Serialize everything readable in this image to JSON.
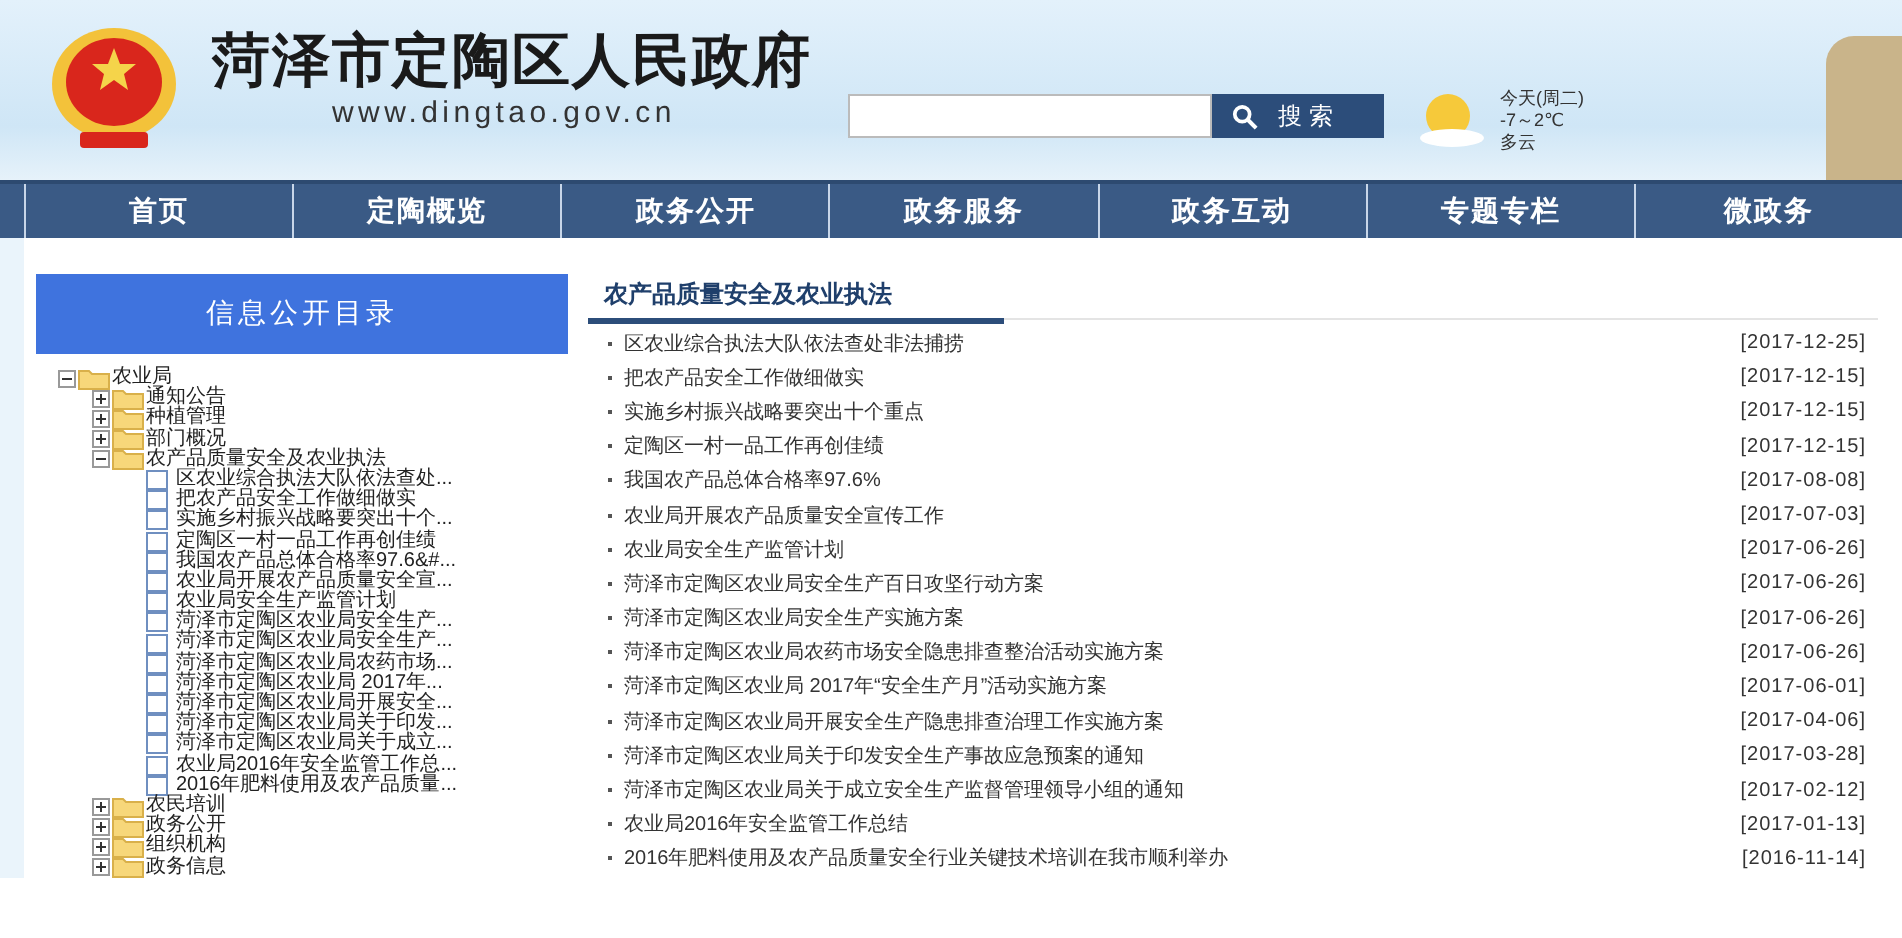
{
  "header": {
    "title": "菏泽市定陶区人民政府",
    "url": "www.dingtao.gov.cn",
    "search": {
      "button": "搜 索"
    },
    "weather": {
      "day": "今天(周二)",
      "temp": "-7～2℃",
      "sky": "多云"
    }
  },
  "nav": [
    "首页",
    "定陶概览",
    "政务公开",
    "政务服务",
    "政务互动",
    "专题专栏",
    "微政务"
  ],
  "sidebar": {
    "title": "信息公开目录",
    "tree": [
      {
        "label": "农业局",
        "kind": "folder",
        "expanded": true,
        "children": [
          {
            "label": "通知公告",
            "kind": "folder",
            "expanded": false
          },
          {
            "label": "种植管理",
            "kind": "folder",
            "expanded": false
          },
          {
            "label": "部门概况",
            "kind": "folder",
            "expanded": false
          },
          {
            "label": "农产品质量安全及农业执法",
            "kind": "folder",
            "expanded": true,
            "children": [
              {
                "label": "区农业综合执法大队依法查处...",
                "kind": "doc"
              },
              {
                "label": "把农产品安全工作做细做实",
                "kind": "doc"
              },
              {
                "label": "实施乡村振兴战略要突出十个...",
                "kind": "doc"
              },
              {
                "label": "定陶区一村一品工作再创佳绩",
                "kind": "doc"
              },
              {
                "label": "我国农产品总体合格率97.6&#...",
                "kind": "doc"
              },
              {
                "label": "农业局开展农产品质量安全宣...",
                "kind": "doc"
              },
              {
                "label": "农业局安全生产监管计划",
                "kind": "doc"
              },
              {
                "label": "菏泽市定陶区农业局安全生产...",
                "kind": "doc"
              },
              {
                "label": "菏泽市定陶区农业局安全生产...",
                "kind": "doc"
              },
              {
                "label": "菏泽市定陶区农业局农药市场...",
                "kind": "doc"
              },
              {
                "label": "菏泽市定陶区农业局 2017年...",
                "kind": "doc"
              },
              {
                "label": "菏泽市定陶区农业局开展安全...",
                "kind": "doc"
              },
              {
                "label": "菏泽市定陶区农业局关于印发...",
                "kind": "doc"
              },
              {
                "label": "菏泽市定陶区农业局关于成立...",
                "kind": "doc"
              },
              {
                "label": "农业局2016年安全监管工作总...",
                "kind": "doc"
              },
              {
                "label": "2016年肥料使用及农产品质量...",
                "kind": "doc"
              }
            ]
          },
          {
            "label": "农民培训",
            "kind": "folder",
            "expanded": false
          },
          {
            "label": "政务公开",
            "kind": "folder",
            "expanded": false
          },
          {
            "label": "组织机构",
            "kind": "folder",
            "expanded": false
          },
          {
            "label": "政务信息",
            "kind": "folder",
            "expanded": false
          }
        ]
      }
    ]
  },
  "content": {
    "title": "农产品质量安全及农业执法",
    "items": [
      {
        "title": "区农业综合执法大队依法查处非法捕捞",
        "date": "[2017-12-25]"
      },
      {
        "title": "把农产品安全工作做细做实",
        "date": "[2017-12-15]"
      },
      {
        "title": "实施乡村振兴战略要突出十个重点",
        "date": "[2017-12-15]"
      },
      {
        "title": "定陶区一村一品工作再创佳绩",
        "date": "[2017-12-15]"
      },
      {
        "title": "我国农产品总体合格率97.6%",
        "date": "[2017-08-08]"
      },
      {
        "title": "农业局开展农产品质量安全宣传工作",
        "date": "[2017-07-03]"
      },
      {
        "title": "农业局安全生产监管计划",
        "date": "[2017-06-26]"
      },
      {
        "title": "菏泽市定陶区农业局安全生产百日攻坚行动方案",
        "date": "[2017-06-26]"
      },
      {
        "title": "菏泽市定陶区农业局安全生产实施方案",
        "date": "[2017-06-26]"
      },
      {
        "title": "菏泽市定陶区农业局农药市场安全隐患排查整治活动实施方案",
        "date": "[2017-06-26]"
      },
      {
        "title": "菏泽市定陶区农业局 2017年“安全生产月”活动实施方案",
        "date": "[2017-06-01]"
      },
      {
        "title": "菏泽市定陶区农业局开展安全生产隐患排查治理工作实施方案",
        "date": "[2017-04-06]"
      },
      {
        "title": "菏泽市定陶区农业局关于印发安全生产事故应急预案的通知",
        "date": "[2017-03-28]"
      },
      {
        "title": "菏泽市定陶区农业局关于成立安全生产监督管理领导小组的通知",
        "date": "[2017-02-12]"
      },
      {
        "title": "农业局2016年安全监管工作总结",
        "date": "[2017-01-13]"
      },
      {
        "title": "2016年肥料使用及农产品质量安全行业关键技术培训在我市顺利举办",
        "date": "[2016-11-14]"
      }
    ]
  }
}
